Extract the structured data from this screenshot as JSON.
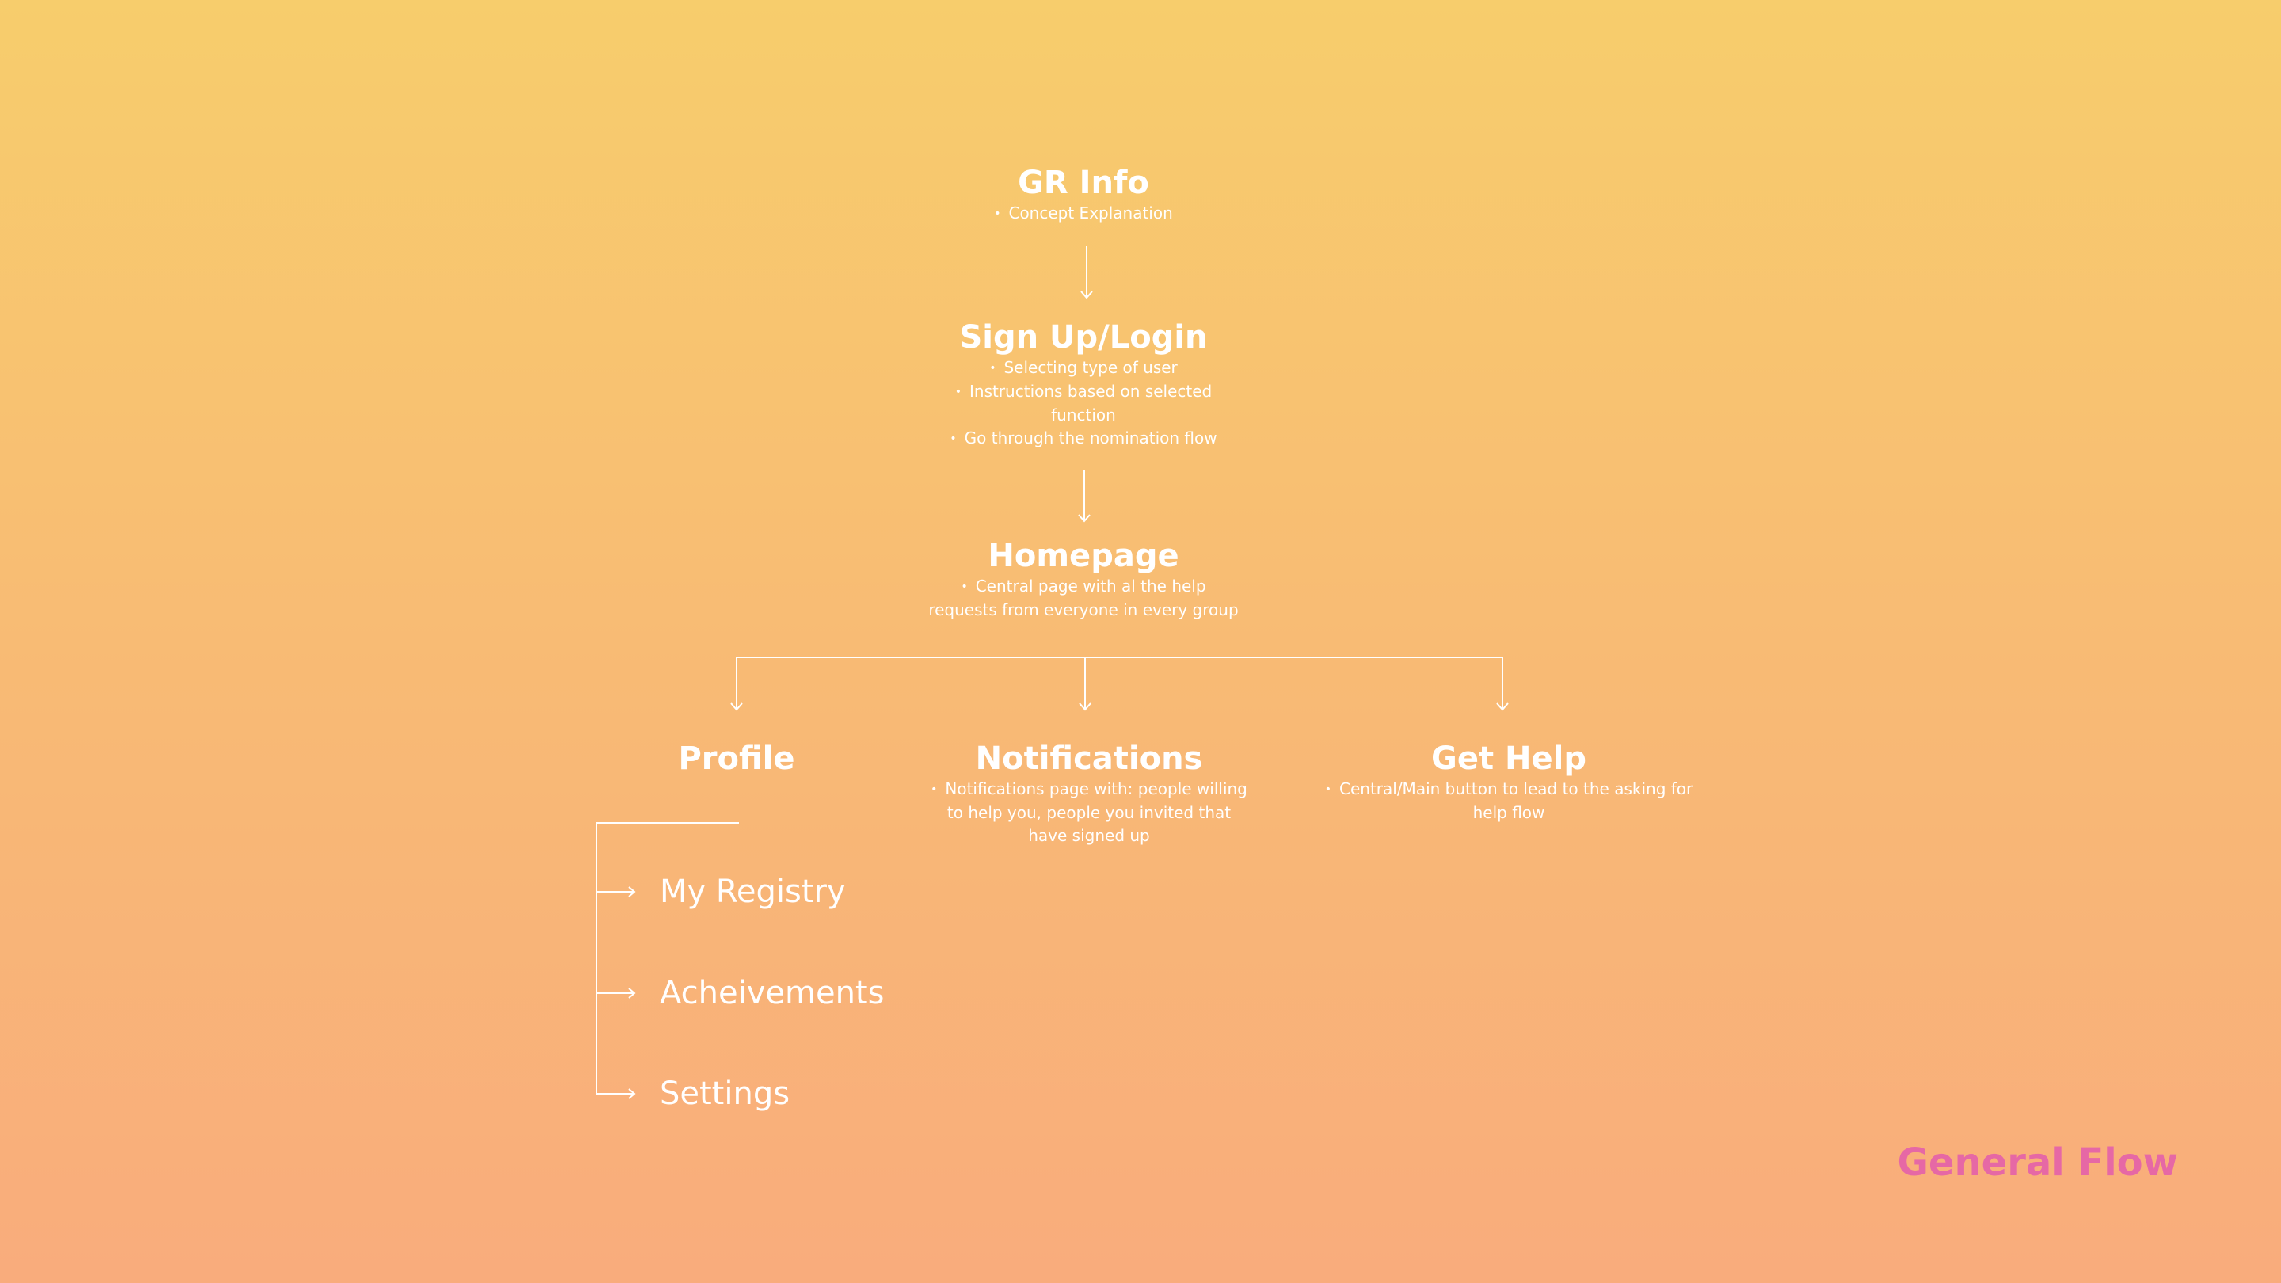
{
  "nodes": {
    "gr_info": {
      "title": "GR Info",
      "bullets": [
        "Concept Explanation"
      ]
    },
    "signup": {
      "title": "Sign Up/Login",
      "bullets": [
        "Selecting type of user",
        "Instructions based on selected function",
        "Go through the nomination flow"
      ]
    },
    "homepage": {
      "title": "Homepage",
      "bullets": [
        "Central page with al the help requests from everyone in every group"
      ]
    },
    "profile": {
      "title": "Profile",
      "bullets": []
    },
    "notifications": {
      "title": "Notifications",
      "bullets": [
        "Notifications page with: people willing to help you, people you invited that have signed up"
      ]
    },
    "get_help": {
      "title": "Get Help",
      "bullets": [
        "Central/Main button to lead to the asking for help flow"
      ]
    }
  },
  "profile_items": [
    "My Registry",
    "Acheivements",
    "Settings"
  ],
  "footer_title": "General Flow",
  "colors": {
    "background_top": "#f7cd6c",
    "background_bottom": "#f9ac7c",
    "text": "#ffffff",
    "accent": "#e668a5"
  }
}
